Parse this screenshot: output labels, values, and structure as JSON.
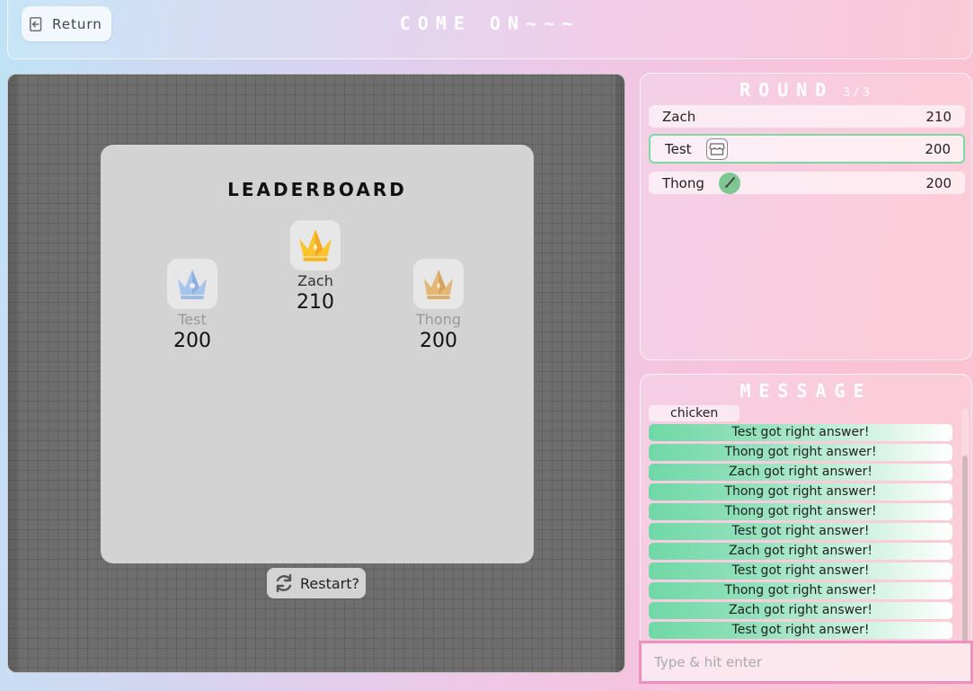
{
  "header": {
    "return_label": "Return",
    "return_icon": "logout-icon",
    "title": "COME ON~~~"
  },
  "leaderboard": {
    "title": "LEADERBOARD",
    "first": {
      "name": "Zach",
      "score": "210",
      "icon": "gold-crown-icon"
    },
    "second": {
      "name": "Test",
      "score": "200",
      "icon": "silver-crown-icon"
    },
    "third": {
      "name": "Thong",
      "score": "200",
      "icon": "bronze-crown-icon"
    },
    "restart_label": "Restart?",
    "restart_icon": "refresh-icon"
  },
  "round": {
    "title": "ROUND",
    "count": "3/3",
    "players": [
      {
        "name": "Zach",
        "score": "210"
      },
      {
        "name": "Test",
        "score": "200",
        "badge": "shop-icon",
        "current": true
      },
      {
        "name": "Thong",
        "score": "200",
        "badge": "brush-icon"
      }
    ]
  },
  "message": {
    "title": "MESSAGE",
    "items": [
      {
        "text": "chicken",
        "type": "plain"
      },
      {
        "text": "Test got right answer!",
        "type": "right"
      },
      {
        "text": "Thong got right answer!",
        "type": "right"
      },
      {
        "text": "Zach got right answer!",
        "type": "right"
      },
      {
        "text": "Thong got right answer!",
        "type": "right"
      },
      {
        "text": "Thong got right answer!",
        "type": "right"
      },
      {
        "text": "Test got right answer!",
        "type": "right"
      },
      {
        "text": "Zach got right answer!",
        "type": "right"
      },
      {
        "text": "Test got right answer!",
        "type": "right"
      },
      {
        "text": "Thong got right answer!",
        "type": "right"
      },
      {
        "text": "Zach got right answer!",
        "type": "right"
      },
      {
        "text": "Test got right answer!",
        "type": "right"
      }
    ],
    "input_placeholder": "Type & hit enter"
  },
  "colors": {
    "correct_green": "#6fd8a6",
    "input_border": "#ef8fbd",
    "current_player_border": "#7fd7a2"
  }
}
